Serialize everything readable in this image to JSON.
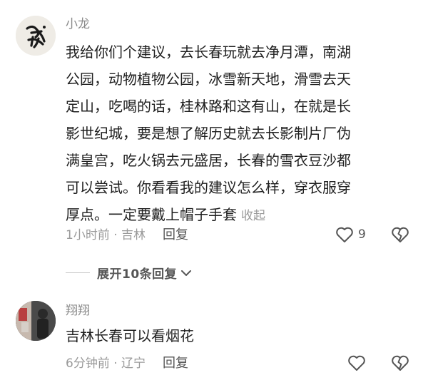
{
  "comments": [
    {
      "username": "小龙",
      "lines": [
        "我给你们个建议，去长春玩就去净月潭，南湖",
        "公园，动物植物公园，冰雪新天地，滑雪去天",
        "定山，吃喝的话，桂林路和这有山，在就是长",
        "影世纪城，要是想了解历史就去长影制片厂伪",
        "满皇宫，吃火锅去元盛居，长春的雪衣豆沙都",
        "可以尝试。你看看我的建议怎么样，穿衣服穿",
        "厚点。一定要戴上帽子手套"
      ],
      "collapse_label": "收起",
      "time_location": "1小时前 · 吉林",
      "reply_label": "回复",
      "like_count": "9",
      "avatar_glyph": "盘"
    },
    {
      "username": "翔翔",
      "text": "吉林长春可以看烟花",
      "time_location": "6分钟前 · 辽宁",
      "reply_label": "回复"
    }
  ],
  "expand_replies_label": "展开10条回复",
  "colors": {
    "text": "#1f1f1f",
    "muted": "#9a9a9a",
    "username": "#8a8a8a"
  },
  "icons": [
    "heart-icon",
    "broken-heart-icon",
    "chevron-down-icon"
  ]
}
